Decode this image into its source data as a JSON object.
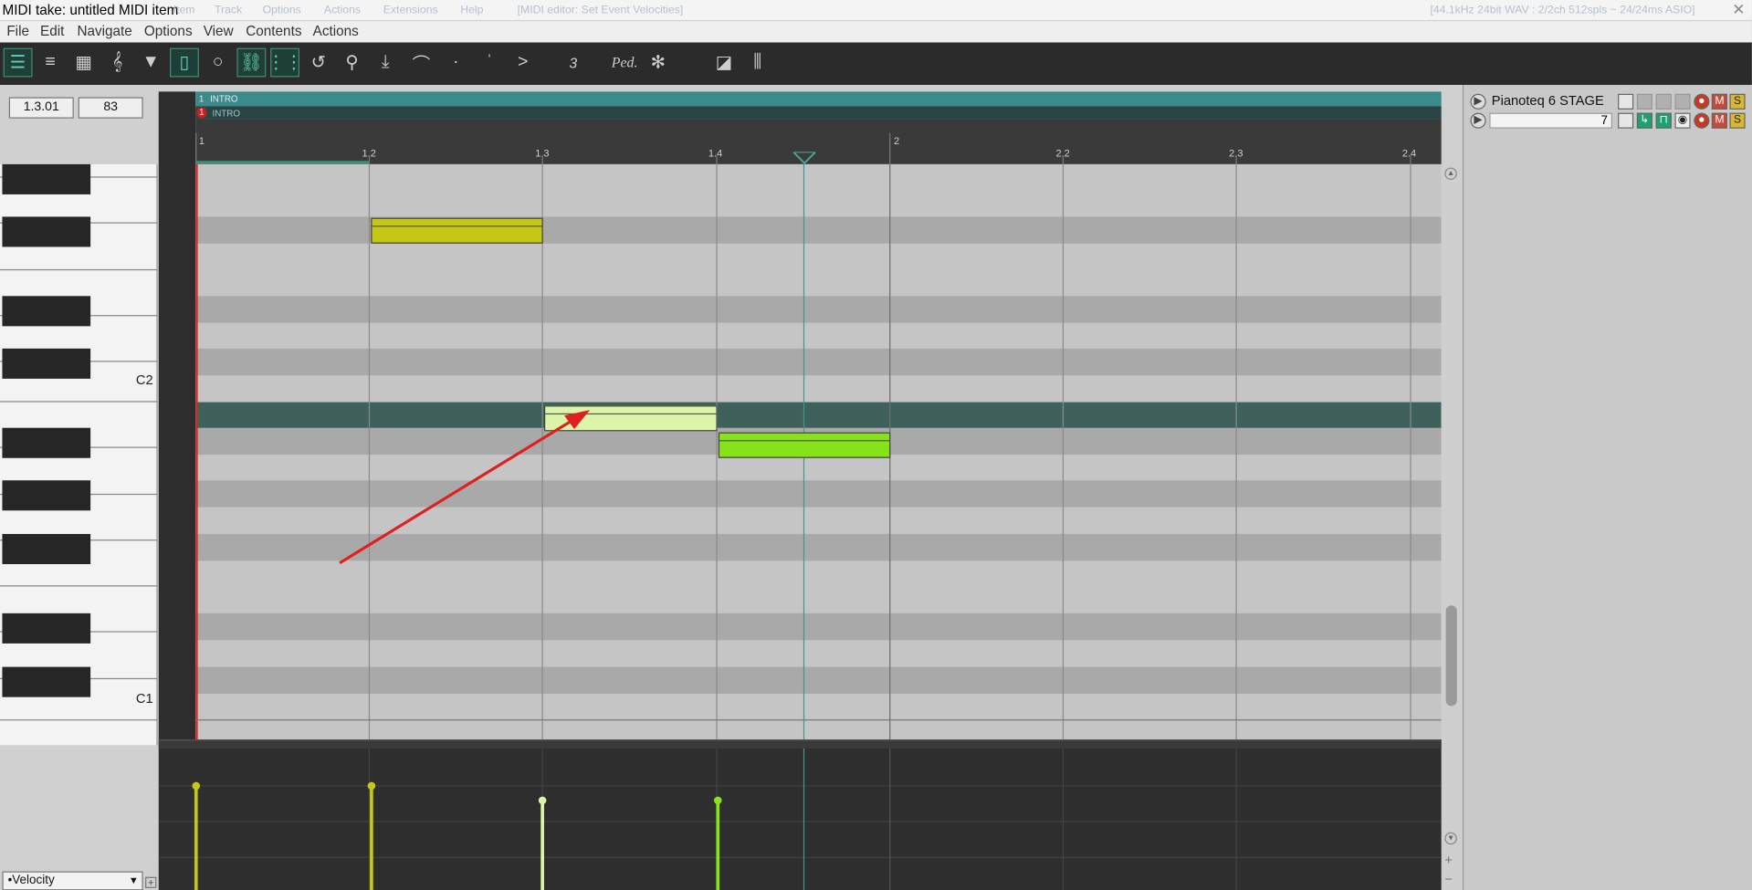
{
  "window": {
    "title": "MIDI take: untitled MIDI item",
    "ghost_menus": [
      "Item",
      "Track",
      "Options",
      "Actions",
      "Extensions",
      "Help",
      "[MIDI editor: Set Event Velocities]"
    ],
    "ghost_status": "[44.1kHz 24bit WAV : 2/2ch 512spls ~ 24/24ms ASIO]"
  },
  "menubar": {
    "items": [
      "File",
      "Edit",
      "Navigate",
      "Options",
      "View",
      "Contents",
      "Actions"
    ]
  },
  "toolbar": {
    "buttons": [
      {
        "icon": "piano-roll-icon",
        "active": true
      },
      {
        "icon": "named-notes-icon",
        "active": false
      },
      {
        "icon": "event-list-icon",
        "active": false
      },
      {
        "icon": "notation-icon",
        "active": false
      },
      {
        "icon": "filter-icon",
        "active": false
      },
      {
        "icon": "note-properties-icon",
        "active": true
      },
      {
        "icon": "loop-icon",
        "active": false
      },
      {
        "icon": "link-items-icon",
        "active": true
      },
      {
        "icon": "grid-icon",
        "active": true
      },
      {
        "icon": "undo-icon",
        "active": false
      },
      {
        "icon": "step-input-icon",
        "active": false
      },
      {
        "icon": "insert-icon",
        "active": false
      },
      {
        "icon": "curve-icon",
        "active": false
      },
      {
        "icon": "staccato-icon",
        "active": false
      },
      {
        "icon": "accent-icon",
        "active": false
      },
      {
        "icon": "decrescendo-icon",
        "active": false
      },
      {
        "icon": "triplet-icon",
        "active": false
      },
      {
        "icon": "pedal-icon",
        "active": false
      },
      {
        "icon": "pedal-release-icon",
        "active": false
      },
      {
        "icon": "dock-icon",
        "active": false
      },
      {
        "icon": "mixer-icon",
        "active": false
      }
    ],
    "triplet_label": "3",
    "pedal_label": "Ped."
  },
  "position_field": "1.3.01",
  "velocity_field": "83",
  "keyboard": {
    "labels": [
      "C2",
      "C1"
    ]
  },
  "region": {
    "number": "1",
    "name": "INTRO",
    "sub_number": "1",
    "sub_name": "INTRO"
  },
  "ruler": {
    "labels": [
      "1",
      "1.2",
      "1.3",
      "1.4",
      "2",
      "2.2",
      "2.3",
      "2.4"
    ]
  },
  "notes": [
    {
      "start": "1.2",
      "end": "1.3",
      "row": 2,
      "color": "#c4c814",
      "selected": false
    },
    {
      "start": "1.3",
      "end": "1.4",
      "row": 9,
      "color": "#dcf5a8",
      "selected": true
    },
    {
      "start": "1.4",
      "end": "2",
      "row": 10,
      "color": "#86e31a",
      "selected": false
    }
  ],
  "velocities": [
    {
      "position": "1",
      "color": "#c4c814"
    },
    {
      "position": "1.2",
      "color": "#c4c814"
    },
    {
      "position": "1.3",
      "color": "#dcf5a8"
    },
    {
      "position": "1.4",
      "color": "#86e31a"
    }
  ],
  "track_panel": {
    "track_name": "Pianoteq 6 STAGE",
    "channel": "7",
    "mute_label": "M",
    "solo_label": "S"
  },
  "cc_lane": {
    "selected": "•Velocity",
    "add_label": "+"
  },
  "colors": {
    "accent": "#3f8d78",
    "selected_lane": "#3f615b",
    "arrow": "#e02020"
  }
}
